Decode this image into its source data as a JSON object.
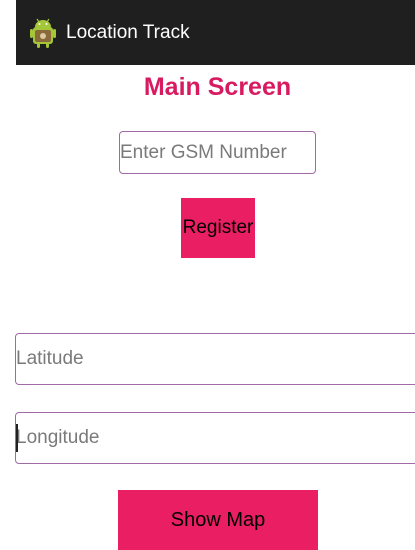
{
  "action_bar": {
    "title": "Location Track",
    "icon": "android-icon",
    "background": "#1f1f1f"
  },
  "main": {
    "title": "Main Screen",
    "title_color": "#d81b60",
    "gsm_field": {
      "placeholder": "Enter GSM Number",
      "value": ""
    },
    "register_label": "Register",
    "latitude_field": {
      "placeholder": "Latitude",
      "value": ""
    },
    "longitude_field": {
      "placeholder": "Longitude",
      "value": ""
    },
    "show_map_label": "Show Map",
    "accent_color": "#e91e63",
    "field_border_color": "#a06aa6"
  }
}
